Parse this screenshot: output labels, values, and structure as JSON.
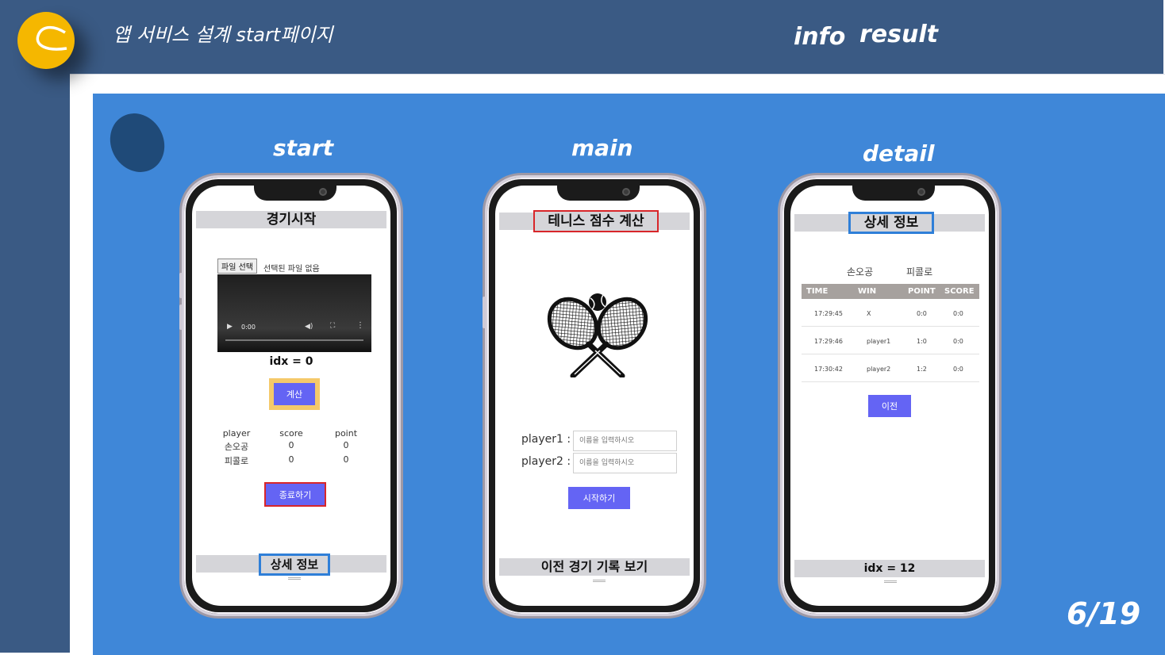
{
  "slide": {
    "title": "앱 서비스 설계 start페이지",
    "nav": {
      "info": "info",
      "result": "result"
    },
    "counter": "6/19",
    "colors": {
      "header": "#3a5a84",
      "panel": "#3f87d8",
      "logo": "#f5b700",
      "oval": "#1f4a78"
    }
  },
  "screens": {
    "start": {
      "heading": "start",
      "title_bar": "경기시작",
      "file_button": "파일 선택",
      "file_status": "선택된 파일 없음",
      "video_time": "0:00",
      "idx_label": "idx = 0",
      "calc_button": "계산",
      "table": {
        "headers": [
          "player",
          "score",
          "point"
        ],
        "rows": [
          [
            "손오공",
            "0",
            "0"
          ],
          [
            "피콜로",
            "0",
            "0"
          ]
        ]
      },
      "end_button": "종료하기",
      "bottom_bar": "상세 정보"
    },
    "main": {
      "heading": "main",
      "title_bar": "테니스 점수 계산",
      "icon": "tennis-rackets-icon",
      "player1_label": "player1 :",
      "player2_label": "player2 :",
      "input_placeholder": "이름을 입력하시오",
      "start_button": "시작하기",
      "bottom_bar": "이전 경기 기록 보기"
    },
    "detail": {
      "heading": "detail",
      "title_bar": "상세 정보",
      "player_a": "손오공",
      "player_b": "피콜로",
      "headers": [
        "TIME",
        "WIN",
        "POINT",
        "SCORE"
      ],
      "rows": [
        [
          "17:29:45",
          "X",
          "0:0",
          "0:0"
        ],
        [
          "17:29:46",
          "player1",
          "1:0",
          "0:0"
        ],
        [
          "17:30:42",
          "player2",
          "1:2",
          "0:0"
        ]
      ],
      "prev_button": "이전",
      "bottom_bar": "idx = 12"
    }
  }
}
